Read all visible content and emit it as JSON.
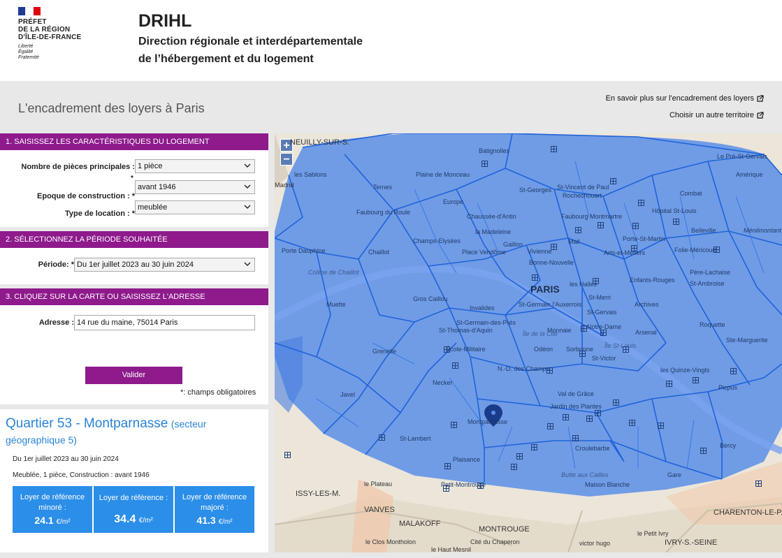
{
  "header": {
    "logo_line1": "PRÉFET",
    "logo_line2": "DE LA RÉGION",
    "logo_line3": "D'ÎLE-DE-FRANCE",
    "motto1": "Liberté",
    "motto2": "Égalité",
    "motto3": "Fraternité",
    "title": "DRIHL",
    "subtitle1": "Direction régionale et interdépartementale",
    "subtitle2": "de l’hébergement et du logement"
  },
  "page_title": "L'encadrement des loyers à Paris",
  "links": {
    "learn_more": "En savoir plus sur l'encadrement des loyers",
    "other_territory": "Choisir un autre territoire"
  },
  "section1": {
    "title": "1. SAISISSEZ LES CARACTÉRISTIQUES DU LOGEMENT",
    "rooms_label": "Nombre de pièces principales :",
    "rooms_value": "1 pièce",
    "epoch_label": "Epoque de construction :",
    "epoch_value": "avant 1946",
    "type_label": "Type de location :",
    "type_value": "meublée",
    "required_mark": "*"
  },
  "section2": {
    "title": "2. SÉLECTIONNEZ LA PÉRIODE SOUHAITÉE",
    "period_label": "Période:",
    "period_value": "Du 1er juillet 2023 au 30 juin 2024"
  },
  "section3": {
    "title": "3. CLIQUEZ SUR LA CARTE OU SAISISSEZ L'ADRESSE",
    "address_label": "Adresse :",
    "address_value": "14 rue du maine, 75014 Paris",
    "submit": "Valider",
    "mandatory_note": "*: champs obligatoires"
  },
  "result": {
    "quartier": "Quartier 53 - Montparnasse",
    "sector": "(secteur géographique 5)",
    "period": "Du 1er juillet 2023 au 30 juin 2024",
    "description": "Meublée, 1 pièce, Construction : avant 1946",
    "cards": [
      {
        "label": "Loyer de référence minoré :",
        "value": "24.1",
        "unit": "€/m²"
      },
      {
        "label": "Loyer de référence :",
        "value": "34.4",
        "unit": "€/m²"
      },
      {
        "label": "Loyer de référence majoré :",
        "value": "41.3",
        "unit": "€/m²"
      }
    ]
  },
  "map": {
    "zoom_in": "+",
    "zoom_out": "−",
    "labels": {
      "paris": "PARIS",
      "neuilly": "NEUILLY-SUR-S.",
      "batignolles": "Batignolles",
      "pre_st_gervais": "Le Pré-St-Gervais",
      "sablons": "les Sablons",
      "madrid": "Madrid",
      "plaine_monceau": "Plaine de Monceau",
      "st_georges": "St-Georges",
      "st_vincent": "St-Vincent de Paul",
      "rochechouart": "Rochechouart",
      "ternes": "Ternes",
      "combat": "Combat",
      "amerique": "Amérique",
      "europe": "Europe",
      "hopital_st_louis": "Hôpital St-Louis",
      "faubourg_roule": "Faubourg du Roule",
      "chaussee_antin": "Chaussée-d'Antin",
      "faubourg_montmartre": "Faubourg Montmartre",
      "madeleine": "la Madeleine",
      "porte_st_martin": "Porte-St-Martin",
      "belleville": "Belleville",
      "menilmontant": "Ménilmontant",
      "champs_elysees": "Champs-Elysées",
      "gaillon": "Gaillon",
      "mail": "Mail",
      "porte_dauphine": "Porte Dauphine",
      "chaillot": "Chaillot",
      "place_vendome": "Place Vendôme",
      "vivienne": "Vivienne",
      "arts_metiers": "Arts-et-Métiers",
      "folie_mericourt": "Folie-Méricourt",
      "bonne_nouvelle": "Bonne-Nouvelle",
      "colline_chaillot": "Colline de Chaillot",
      "pere_lachaise": "Père-Lachaise",
      "enfants_rouges": "Enfants-Rouges",
      "st_ambroise": "St-Ambroise",
      "halles": "les Halles",
      "gros_caillou": "Gros Caillou",
      "muette": "Muette",
      "invalides": "Invalides",
      "st_germain_auxerrois": "St-Germain l'Auxerrois",
      "st_merri": "St-Merri",
      "archives": "Archives",
      "st_gervais": "St-Gervais",
      "st_germain_pres": "St-Germain-des-Prés",
      "st_thomas_aquin": "St-Thomas-d'Aquin",
      "monnaie": "Monnaie",
      "notre_dame": "Notre-Dame",
      "roquette": "Roquette",
      "ile_cite": "Île de la Cité",
      "arsenal": "Arsenal",
      "ile_st_louis": "Île St-Louis",
      "grenelle": "Grenelle",
      "ecole_militaire": "École-Militaire",
      "odeon": "Odéon",
      "sorbonne": "Sorbonne",
      "ste_marguerite": "Ste-Marguerite",
      "st_victor": "St-Victor",
      "quinze_vingts": "les Quinze-Vingts",
      "nd_champs": "N.-D. des Champs",
      "necker": "Necker",
      "javel": "Javel",
      "val_grace": "Val de Grâce",
      "picpus": "Picpus",
      "jardin_plantes": "Jardin des Plantes",
      "montparnasse": "Montparnasse",
      "st_lambert": "St-Lambert",
      "croulebarbe": "Croulebarbe",
      "bercy": "Bercy",
      "plaisance": "Plaisance",
      "butte_cailles": "Butte aux Cailles",
      "gare": "Gare",
      "petit_montrouge": "Petit-Montrouge",
      "maison_blanche": "Maison Blanche",
      "plateau": "le Plateau",
      "issy": "ISSY-LES-M.",
      "vanves": "VANVES",
      "malakoff": "MALAKOFF",
      "montrouge": "MONTROUGE",
      "charenton": "CHARENTON-LE-P.",
      "ivry": "IVRY-S.-SEINE",
      "clos_montholon": "le Clos Montholon",
      "cite_chaperon": "Cité du Chaperon",
      "haut_mesnil": "le Haut Mesnil",
      "victor_hugo": "victor hugo",
      "petit_ivry": "le Petit Ivry"
    }
  }
}
